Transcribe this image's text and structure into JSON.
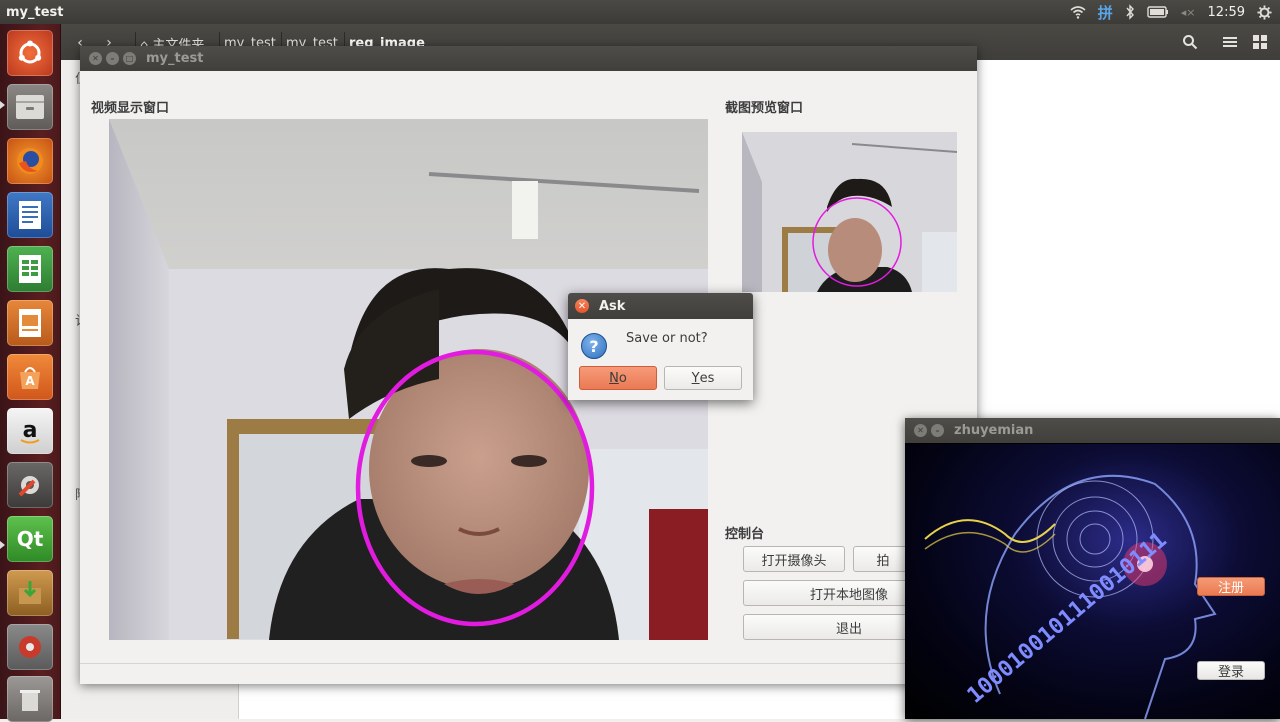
{
  "top_panel": {
    "app_title": "my_test",
    "clock": "12:59",
    "ime": "拼",
    "sound_icon": "◂×"
  },
  "launcher": {
    "items": [
      "ubuntu-dash",
      "files",
      "firefox",
      "writer",
      "calc",
      "impress",
      "software-center",
      "amazon",
      "system-settings",
      "qt-creator",
      "installer",
      "disk",
      "trash"
    ]
  },
  "file_manager": {
    "breadcrumbs": [
      "⌂ 主文件夹",
      "my_test",
      "my_test",
      "reg_image"
    ],
    "side_chars": [
      "位",
      "计",
      "附"
    ]
  },
  "main_window": {
    "title": "my_test",
    "video_label": "视频显示窗口",
    "preview_label": "截图预览窗口",
    "console_label": "控制台",
    "buttons": {
      "open_camera": "打开摄像头",
      "capture": "拍",
      "open_local_image": "打开本地图像",
      "exit": "退出"
    }
  },
  "dialog": {
    "title": "Ask",
    "message": "Save or not?",
    "no": {
      "mnemonic": "N",
      "rest": "o"
    },
    "yes": {
      "mnemonic": "Y",
      "rest": "es"
    }
  },
  "zhu_window": {
    "title": "zhuyemian",
    "register": "注册",
    "login": "登录",
    "digits": "1000100101110010111"
  },
  "colors": {
    "face_ring": "#e21be0",
    "launcher_bg": "#4b1a1c",
    "accent": "#f08156"
  }
}
